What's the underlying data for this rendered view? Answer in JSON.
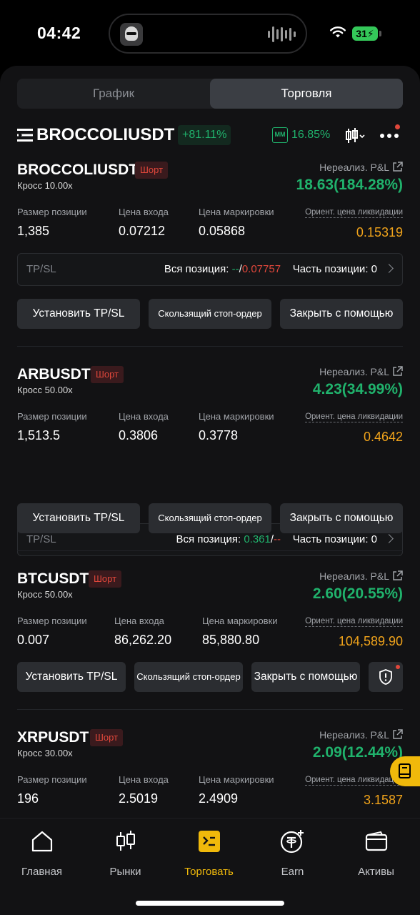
{
  "status": {
    "time": "04:42",
    "battery": "31"
  },
  "tabs": [
    {
      "label": "График",
      "active": false
    },
    {
      "label": "Торговля",
      "active": true
    }
  ],
  "header": {
    "pair": "BROCCOLIUSDT",
    "change": "+81.11%",
    "mm_label": "MM",
    "mm_value": "16.85%"
  },
  "labels": {
    "pnl": "Нереализ. P&L",
    "size": "Размер позиции",
    "entry": "Цена входа",
    "mark": "Цена маркировки",
    "liq": "Ориент. цена ликвидации",
    "tpsl": "TP/SL",
    "all_position": "Вся позиция:",
    "part_position": "Часть позиции:",
    "slash": "/",
    "set_tpsl": "Установить TP/SL",
    "trailing": "Скользящий стоп-ордер",
    "close_with": "Закрыть с помощью"
  },
  "positions": [
    {
      "symbol": "BROCCOLIUSDT",
      "side": "Шорт",
      "leverage": "Кросс 10.00x",
      "pnl": "18.63(184.28%)",
      "size": "1,385",
      "entry": "0.07212",
      "mark": "0.05868",
      "liq": "0.15319",
      "tp": "--",
      "sl": "0.07757",
      "part": "0"
    },
    {
      "symbol": "ARBUSDT",
      "side": "Шорт",
      "leverage": "Кросс 50.00x",
      "pnl": "4.23(34.99%)",
      "size": "1,513.5",
      "entry": "0.3806",
      "mark": "0.3778",
      "liq": "0.4642",
      "tp": "0.361",
      "sl": "--",
      "part": "0"
    },
    {
      "symbol": "BTCUSDT",
      "side": "Шорт",
      "leverage": "Кросс 50.00x",
      "pnl": "2.60(20.55%)",
      "size": "0.007",
      "entry": "86,262.20",
      "mark": "85,880.80",
      "liq": "104,589.90"
    },
    {
      "symbol": "XRPUSDT",
      "side": "Шорт",
      "leverage": "Кросс 30.00x",
      "pnl": "2.09(12.44%)",
      "size": "196",
      "entry": "2.5019",
      "mark": "2.4909",
      "liq": "3.1587"
    }
  ],
  "nav": [
    {
      "label": "Главная",
      "icon": "home-icon"
    },
    {
      "label": "Рынки",
      "icon": "candlestick-icon"
    },
    {
      "label": "Торговать",
      "icon": "trade-icon",
      "active": true
    },
    {
      "label": "Earn",
      "icon": "earn-icon"
    },
    {
      "label": "Активы",
      "icon": "wallet-icon"
    }
  ],
  "colors": {
    "up": "#20b26c",
    "down": "#e0473b",
    "accent": "#f0b90b",
    "liq": "#f0a31b"
  }
}
